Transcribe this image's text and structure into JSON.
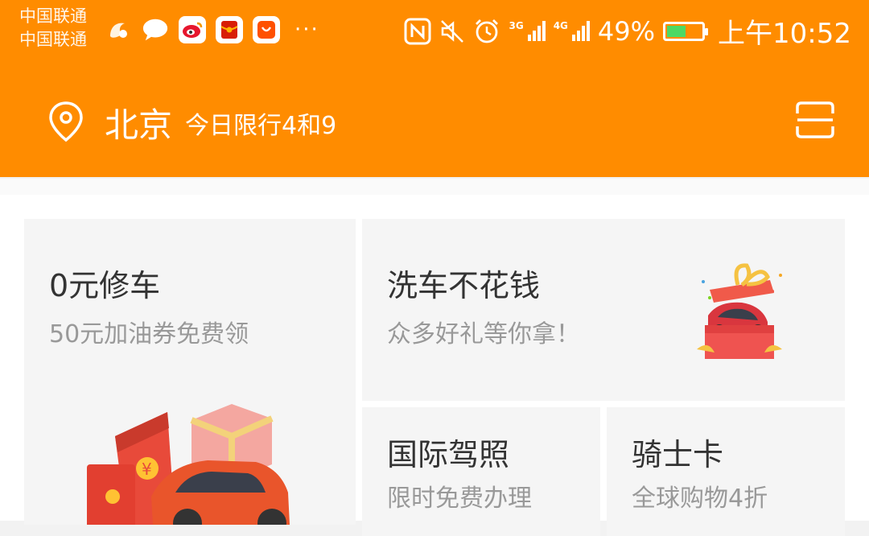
{
  "status_bar": {
    "carrier_1": "中国联通",
    "carrier_2": "中国联通",
    "notification_icons": [
      "uc-browser-icon",
      "message-bubble-icon",
      "weibo-icon",
      "red-envelope-app-icon",
      "shopping-app-icon"
    ],
    "more": "···",
    "network_1": "3G",
    "network_2": "4G",
    "battery_percent": "49%",
    "battery_level": 0.49,
    "time": "上午10:52"
  },
  "header": {
    "city": "北京",
    "restriction": "今日限行4和9",
    "accent_color": "#ff8c00"
  },
  "cards": [
    {
      "title": "0元修车",
      "subtitle": "50元加油券免费领"
    },
    {
      "title": "洗车不花钱",
      "subtitle": "众多好礼等你拿！"
    },
    {
      "title": "国际驾照",
      "subtitle": "限时免费办理"
    },
    {
      "title": "骑士卡",
      "subtitle": "全球购物4折"
    }
  ]
}
